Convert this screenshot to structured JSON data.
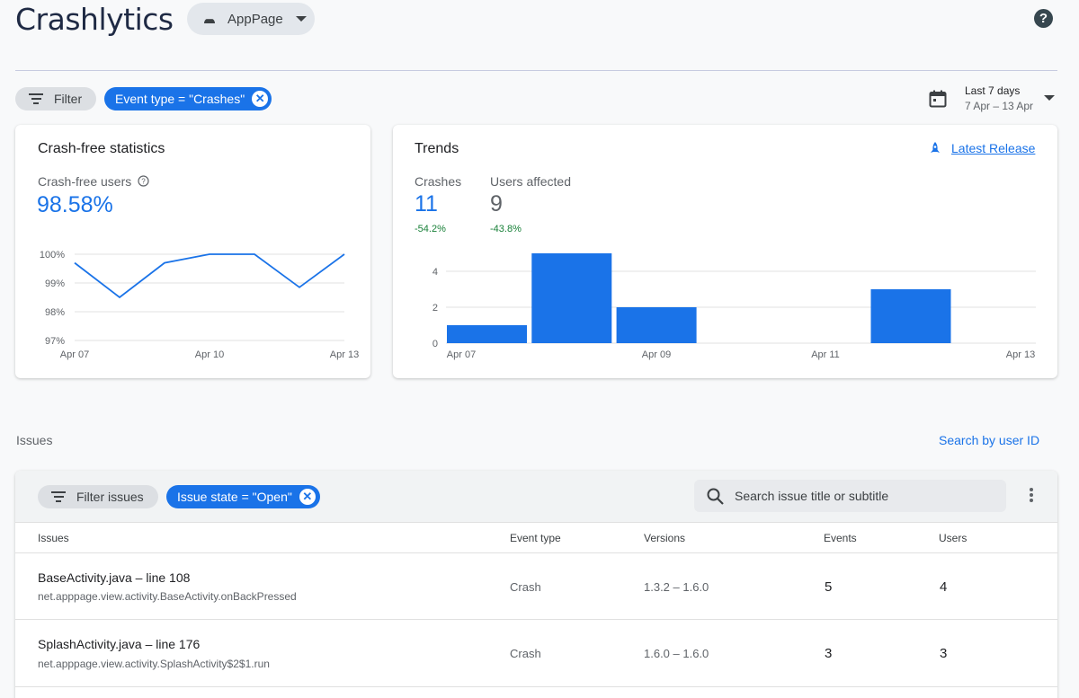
{
  "header": {
    "title": "Crashlytics",
    "app_name": "AppPage",
    "help_icon": "help-circle-icon"
  },
  "filters": {
    "filter_label": "Filter",
    "event_chip": "Event type = \"Crashes\"",
    "date_range_title": "Last 7 days",
    "date_range_sub": "7 Apr – 13 Apr"
  },
  "crash_free": {
    "title": "Crash-free statistics",
    "metric_label": "Crash-free users",
    "metric_value": "98.58%",
    "chart_data": {
      "type": "line",
      "x": [
        "Apr 07",
        "Apr 08",
        "Apr 09",
        "Apr 10",
        "Apr 11",
        "Apr 12",
        "Apr 13"
      ],
      "x_tick_labels": [
        "Apr 07",
        "Apr 10",
        "Apr 13"
      ],
      "y_tick_labels": [
        "100%",
        "99%",
        "98%",
        "97%"
      ],
      "ylim": [
        97,
        100
      ],
      "values": [
        99.7,
        98.5,
        99.7,
        100,
        100,
        98.85,
        100
      ],
      "color": "#1a73e8",
      "grid": true
    }
  },
  "trends": {
    "title": "Trends",
    "latest_release": "Latest Release",
    "crashes_label": "Crashes",
    "crashes_value": "11",
    "crashes_change": "-54.2%",
    "users_label": "Users affected",
    "users_value": "9",
    "users_change": "-43.8%",
    "chart_data": {
      "type": "bar",
      "categories": [
        "Apr 07",
        "Apr 08",
        "Apr 09",
        "Apr 10",
        "Apr 11",
        "Apr 12",
        "Apr 13"
      ],
      "x_tick_labels": [
        "Apr 07",
        "Apr 09",
        "Apr 11",
        "Apr 13"
      ],
      "y_tick_labels": [
        "4",
        "2",
        "0"
      ],
      "ylim": [
        0,
        4
      ],
      "values": [
        1,
        5,
        2,
        0,
        0,
        3,
        0
      ],
      "color": "#1a73e8",
      "grid": true
    }
  },
  "issues": {
    "section_label": "Issues",
    "search_by_user": "Search by user ID",
    "filter_label": "Filter issues",
    "state_chip": "Issue state = \"Open\"",
    "search_placeholder": "Search issue title or subtitle",
    "columns": [
      "Issues",
      "Event type",
      "Versions",
      "Events",
      "Users"
    ],
    "rows": [
      {
        "file": "BaseActivity.java",
        "line": " – line 108",
        "subtitle": "net.apppage.view.activity.BaseActivity.onBackPressed",
        "event_type": "Crash",
        "versions": "1.3.2 – 1.6.0",
        "events": "5",
        "users": "4"
      },
      {
        "file": "SplashActivity.java",
        "line": " – line 176",
        "subtitle": "net.apppage.view.activity.SplashActivity$2$1.run",
        "event_type": "Crash",
        "versions": "1.6.0 – 1.6.0",
        "events": "3",
        "users": "3"
      }
    ]
  }
}
